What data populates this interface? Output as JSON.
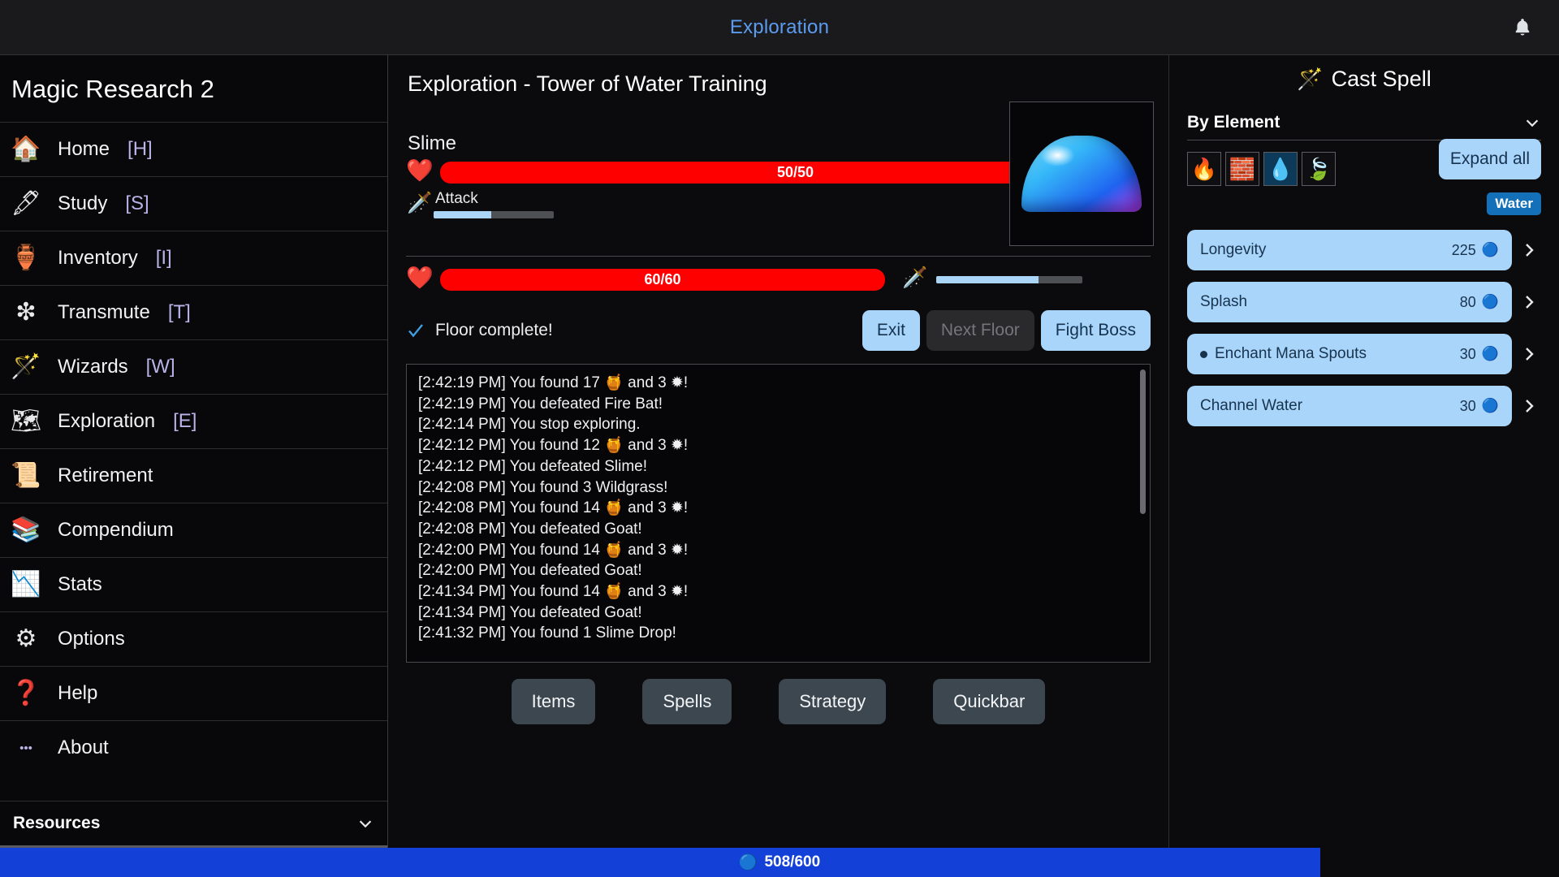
{
  "topbar": {
    "title": "Exploration",
    "bell_icon": "bell-icon"
  },
  "sidebar": {
    "game_title": "Magic Research 2",
    "items": [
      {
        "label": "Home",
        "key": "[H]",
        "icon": "house-icon"
      },
      {
        "label": "Study",
        "key": "[S]",
        "icon": "quill-icon"
      },
      {
        "label": "Inventory",
        "key": "[I]",
        "icon": "pot-icon"
      },
      {
        "label": "Transmute",
        "key": "[T]",
        "icon": "sparkle-icon"
      },
      {
        "label": "Wizards",
        "key": "[W]",
        "icon": "wand-icon"
      },
      {
        "label": "Exploration",
        "key": "[E]",
        "icon": "map-icon"
      },
      {
        "label": "Retirement",
        "key": "",
        "icon": "scroll-icon"
      },
      {
        "label": "Compendium",
        "key": "",
        "icon": "books-icon"
      },
      {
        "label": "Stats",
        "key": "",
        "icon": "chart-icon"
      },
      {
        "label": "Options",
        "key": "",
        "icon": "gear-icon"
      },
      {
        "label": "Help",
        "key": "",
        "icon": "question-icon"
      },
      {
        "label": "About",
        "key": "",
        "icon": "ellipsis-icon"
      }
    ],
    "resources_label": "Resources",
    "resources_chevron": "chevron-down-icon"
  },
  "main": {
    "title": "Exploration - Tower of Water Training",
    "enemy": {
      "name": "Slime",
      "hp_text": "50/50",
      "hp_percent": 100,
      "attack_label": "Attack",
      "attack_percent": 48,
      "portrait_icon": "slime-sprite"
    },
    "player": {
      "hp_text": "60/60",
      "hp_percent": 100,
      "attack_percent": 70
    },
    "status": {
      "icon": "check-icon",
      "text": "Floor complete!"
    },
    "actions": [
      {
        "label": "Exit",
        "disabled": false
      },
      {
        "label": "Next Floor",
        "disabled": true
      },
      {
        "label": "Fight Boss",
        "disabled": false
      }
    ],
    "log": [
      {
        "time": "[2:42:19 PM]",
        "text": "You found 17 \u0000 and 3 \u0000!",
        "parts": [
          "[2:42:19 PM] You found 17 ",
          "🍯",
          " and 3 ",
          "✹",
          "!"
        ]
      },
      {
        "time": "[2:42:19 PM]",
        "text": "You defeated Fire Bat!"
      },
      {
        "time": "[2:42:14 PM]",
        "text": "You stop exploring."
      },
      {
        "time": "[2:42:12 PM]",
        "text": "You found 12 \u0000 and 3 \u0000!"
      },
      {
        "time": "[2:42:12 PM]",
        "text": "You defeated Slime!"
      },
      {
        "time": "[2:42:08 PM]",
        "text": "You found 3 Wildgrass!"
      },
      {
        "time": "[2:42:08 PM]",
        "text": "You found 14 \u0000 and 3 \u0000!"
      },
      {
        "time": "[2:42:08 PM]",
        "text": "You defeated Goat!"
      },
      {
        "time": "[2:42:00 PM]",
        "text": "You found 14 \u0000 and 3 \u0000!"
      },
      {
        "time": "[2:42:00 PM]",
        "text": "You defeated Goat!"
      },
      {
        "time": "[2:41:34 PM]",
        "text": "You found 14 \u0000 and 3 \u0000!"
      },
      {
        "time": "[2:41:34 PM]",
        "text": "You defeated Goat!"
      },
      {
        "time": "[2:41:32 PM]",
        "text": "You found 1 Slime Drop!"
      }
    ],
    "log_lines": [
      "[2:42:19 PM] You found 17 🍯 and 3 ✹!",
      "[2:42:19 PM] You defeated Fire Bat!",
      "[2:42:14 PM] You stop exploring.",
      "[2:42:12 PM] You found 12 🍯 and 3 ✹!",
      "[2:42:12 PM] You defeated Slime!",
      "[2:42:08 PM] You found 3 Wildgrass!",
      "[2:42:08 PM] You found 14 🍯 and 3 ✹!",
      "[2:42:08 PM] You defeated Goat!",
      "[2:42:00 PM] You found 14 🍯 and 3 ✹!",
      "[2:42:00 PM] You defeated Goat!",
      "[2:41:34 PM] You found 14 🍯 and 3 ✹!",
      "[2:41:34 PM] You defeated Goat!",
      "[2:41:32 PM] You found 1 Slime Drop!"
    ],
    "quickbar": [
      {
        "label": "Items"
      },
      {
        "label": "Spells"
      },
      {
        "label": "Strategy"
      },
      {
        "label": "Quickbar"
      }
    ]
  },
  "right": {
    "cast_title": "Cast Spell",
    "cast_icon": "wand-sparkle-icon",
    "group_label": "By Element",
    "group_chevron": "chevron-down-icon",
    "elements": [
      {
        "name": "fire",
        "icon": "fire-icon",
        "selected": false
      },
      {
        "name": "earth",
        "icon": "earth-icon",
        "selected": false
      },
      {
        "name": "water",
        "icon": "water-icon",
        "selected": true
      },
      {
        "name": "air",
        "icon": "air-icon",
        "selected": false
      }
    ],
    "expand_all_label": "Expand all",
    "element_badge": "Water",
    "spells": [
      {
        "name": "Longevity",
        "cost": "225",
        "has_dot": false,
        "arrow": "chevron-right-icon"
      },
      {
        "name": "Splash",
        "cost": "80",
        "has_dot": false,
        "arrow": "chevron-right-icon"
      },
      {
        "name": "Enchant Mana Spouts",
        "cost": "30",
        "has_dot": true,
        "arrow": "chevron-right-icon"
      },
      {
        "name": "Channel Water",
        "cost": "30",
        "has_dot": false,
        "arrow": "chevron-right-icon"
      }
    ]
  },
  "bottom": {
    "mana_icon": "mana-orb-icon",
    "mana_text": "508/600",
    "mana_percent": 84.7,
    "fill_color": "#1341d8"
  }
}
